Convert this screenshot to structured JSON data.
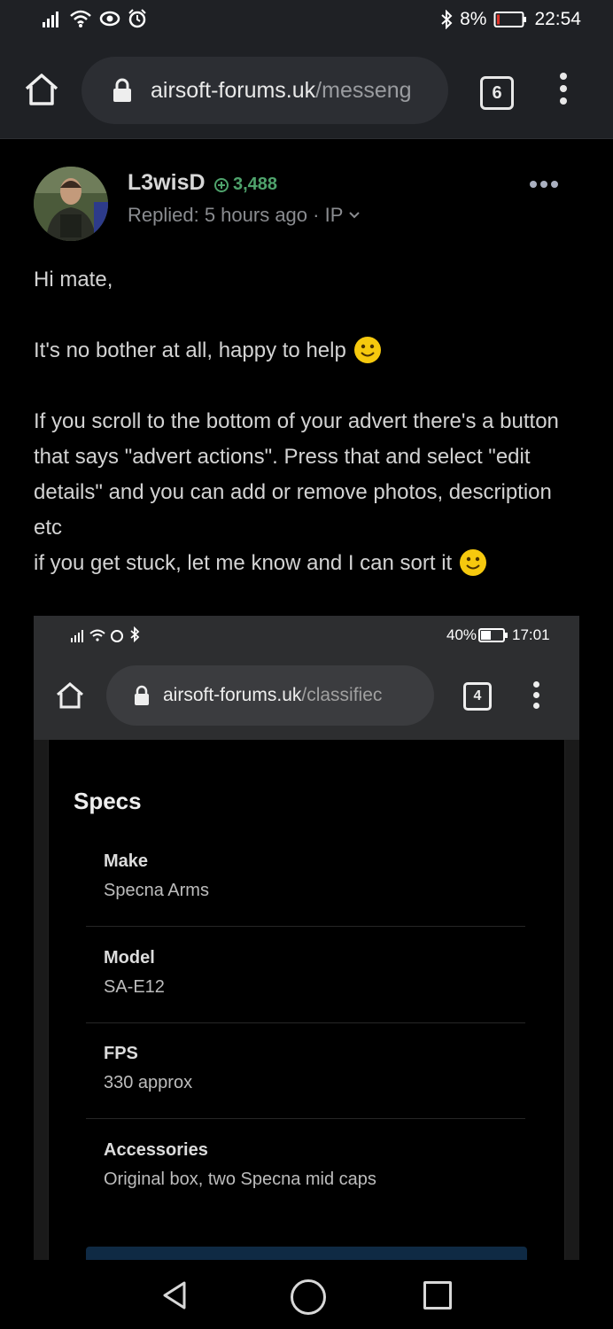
{
  "status_bar": {
    "battery": "8%",
    "time": "22:54"
  },
  "browser": {
    "url_host": "airsoft-forums.uk",
    "url_path": "/messeng",
    "tab_count": "6"
  },
  "post": {
    "username": "L3wisD",
    "reputation": "3,488",
    "meta": "Replied: 5 hours ago · IP",
    "lines": {
      "greeting": "Hi mate,",
      "line2": "It's no bother at all, happy to help",
      "line3": "If you scroll to the bottom of your advert there's a button that says \"advert actions\". Press that and select \"edit details\" and you can add or remove photos, description etc",
      "line4": "if you get stuck, let me know and I can sort it"
    }
  },
  "embedded_screenshot": {
    "battery": "40%",
    "time": "17:01",
    "url_host": "airsoft-forums.uk",
    "url_path": "/classifiec",
    "tab_count": "4",
    "section_title": "Specs",
    "specs": [
      {
        "key": "Make",
        "value": "Specna Arms"
      },
      {
        "key": "Model",
        "value": "SA-E12"
      },
      {
        "key": "FPS",
        "value": "330 approx"
      },
      {
        "key": "Accessories",
        "value": "Original box, two Specna mid caps"
      }
    ]
  },
  "colors": {
    "background": "#000000",
    "chrome": "#1f2125",
    "reputation_green": "#4fa36c",
    "text": "#d3d3d3",
    "muted": "#8a8c90",
    "battery_low": "#e0352b"
  }
}
